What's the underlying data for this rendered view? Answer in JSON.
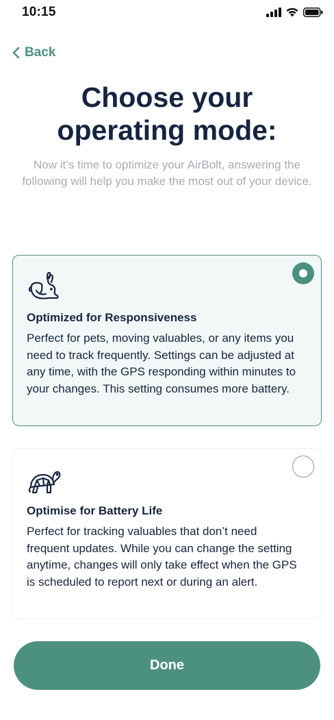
{
  "status_bar": {
    "time": "10:15",
    "icons": [
      "cellular-signal-icon",
      "wifi-icon",
      "battery-icon"
    ]
  },
  "nav": {
    "back_label": "Back",
    "back_icon": "chevron-left-icon"
  },
  "header": {
    "title": "Choose your operating mode:",
    "subtitle": "Now it’s time to optimize your AirBolt, answering the following will help you make the most out of your device."
  },
  "options": [
    {
      "icon": "rabbit-icon",
      "title": "Optimized for Responsiveness",
      "description": "Perfect for pets, moving valuables, or any items you need to track frequently. Settings can be adjusted at any time, with the GPS responding within minutes to your changes. This setting consumes more battery.",
      "selected": true
    },
    {
      "icon": "turtle-icon",
      "title": "Optimise for Battery Life",
      "description": "Perfect for tracking valuables that don’t need frequent updates. While you can change the setting anytime, changes will only take effect when the GPS is scheduled to report next or during an alert.",
      "selected": false
    }
  ],
  "actions": {
    "done_label": "Done"
  },
  "colors": {
    "accent": "#4c9080",
    "title_text": "#17243f",
    "subtitle_text": "#a7acb3",
    "selected_card_bg": "#f2f8f7"
  }
}
